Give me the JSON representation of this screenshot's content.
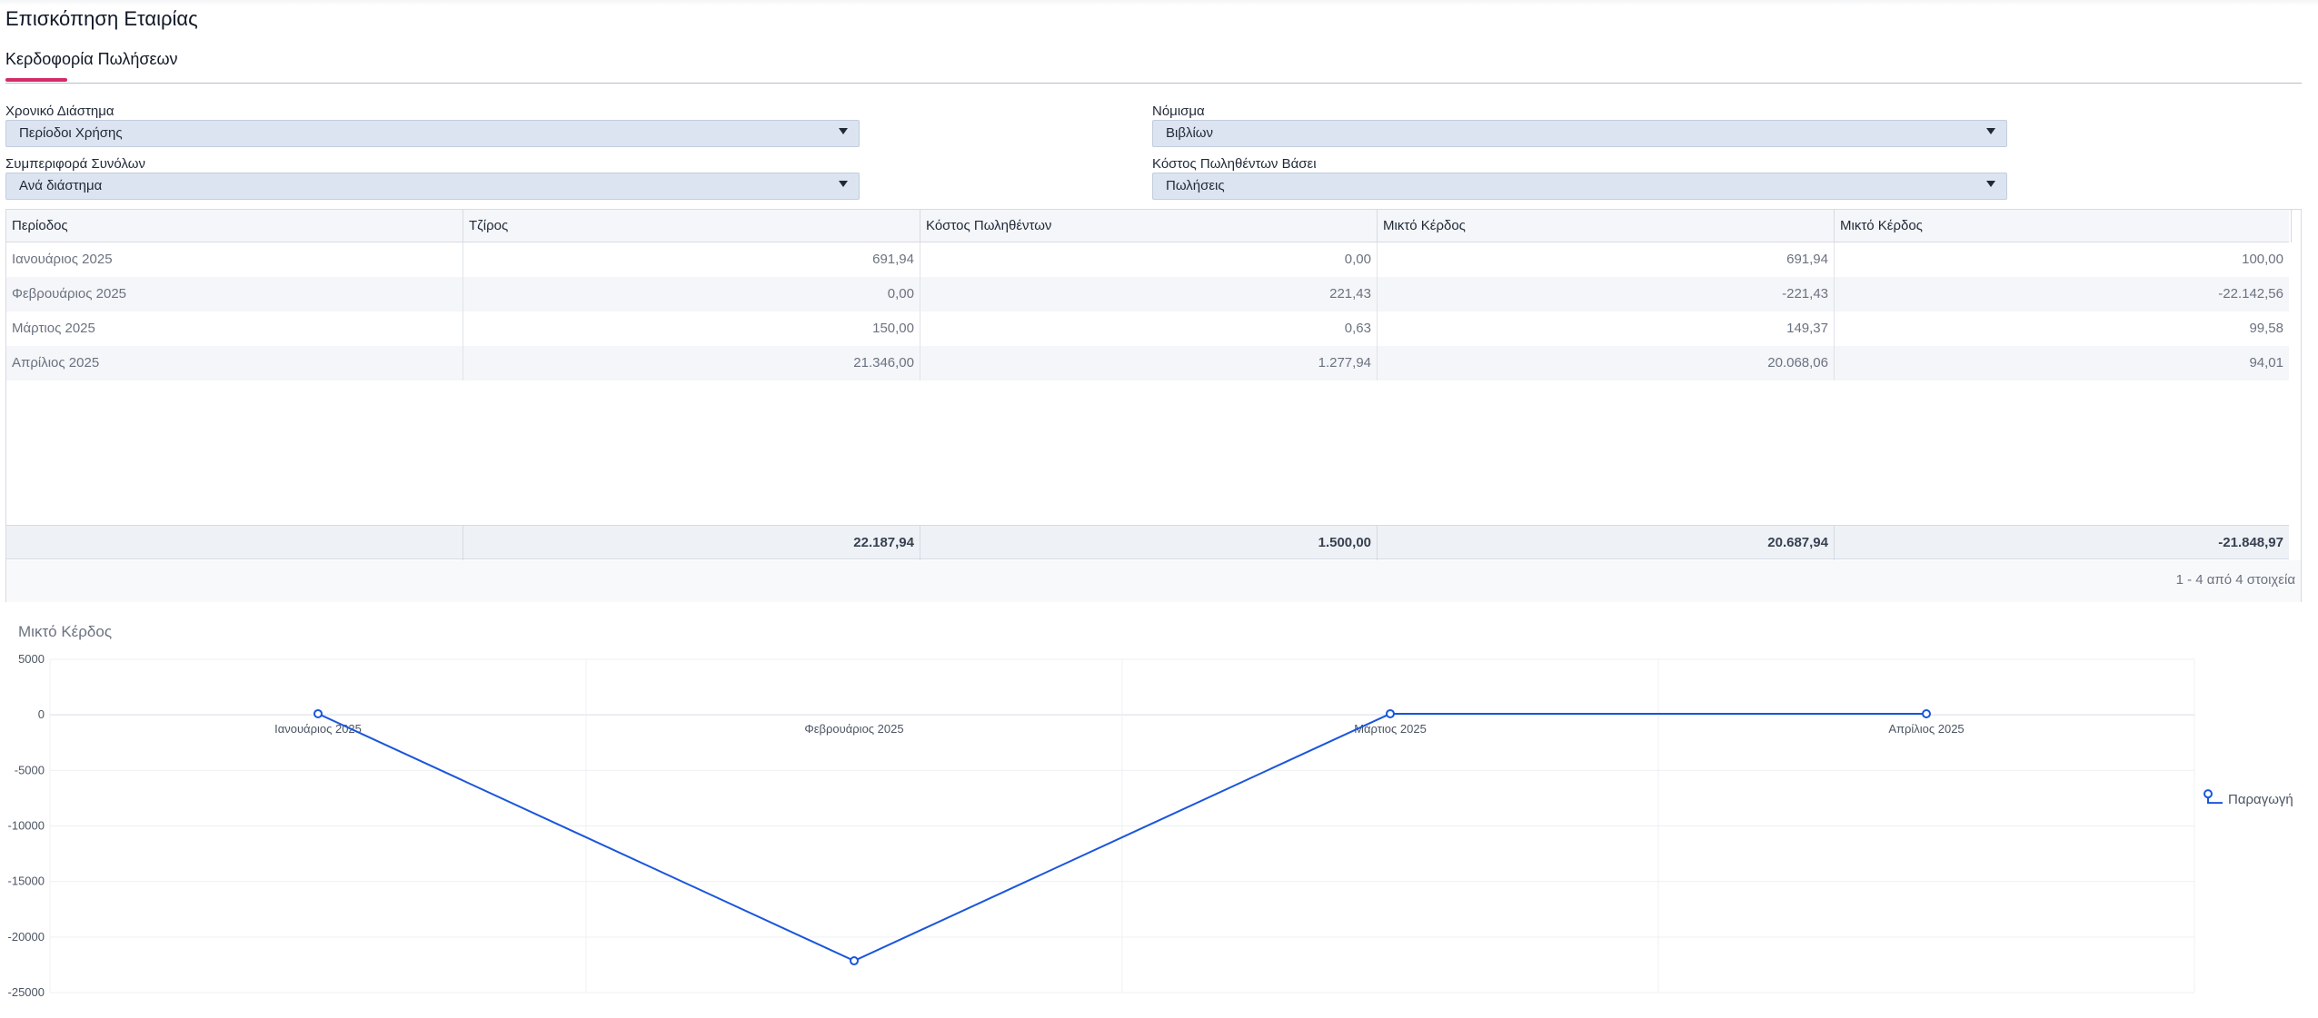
{
  "page": {
    "title": "Επισκόπηση Εταιρίας"
  },
  "tabs": [
    {
      "label": "Κερδοφορία Πωλήσεων",
      "active": true
    }
  ],
  "filters": {
    "time_range": {
      "label": "Χρονικό Διάστημα",
      "value": "Περίοδοι Χρήσης"
    },
    "currency": {
      "label": "Νόμισμα",
      "value": "Βιβλίων"
    },
    "totals_behavior": {
      "label": "Συμπεριφορά Συνόλων",
      "value": "Ανά διάστημα"
    },
    "cogs_basis": {
      "label": "Κόστος Πωληθέντων Βάσει",
      "value": "Πωλήσεις"
    }
  },
  "table": {
    "columns": [
      "Περίοδος",
      "Τζίρος",
      "Κόστος Πωληθέντων",
      "Μικτό Κέρδος",
      "Μικτό Κέρδος"
    ],
    "rows": [
      [
        "Ιανουάριος 2025",
        "691,94",
        "0,00",
        "691,94",
        "100,00"
      ],
      [
        "Φεβρουάριος 2025",
        "0,00",
        "221,43",
        "-221,43",
        "-22.142,56"
      ],
      [
        "Μάρτιος 2025",
        "150,00",
        "0,63",
        "149,37",
        "99,58"
      ],
      [
        "Απρίλιος 2025",
        "21.346,00",
        "1.277,94",
        "20.068,06",
        "94,01"
      ]
    ],
    "totals": [
      "",
      "22.187,94",
      "1.500,00",
      "20.687,94",
      "-21.848,97"
    ],
    "pager": "1 - 4 από 4 στοιχεία"
  },
  "chart_data": {
    "type": "line",
    "title": "Μικτό Κέρδος",
    "categories": [
      "Ιανουάριος 2025",
      "Φεβρουάριος 2025",
      "Μάρτιος 2025",
      "Απρίλιος 2025"
    ],
    "series": [
      {
        "name": "Παραγωγή",
        "values": [
          100.0,
          -22142.56,
          99.58,
          94.01
        ],
        "color": "#1a56db"
      }
    ],
    "ylim": [
      -25000,
      5000
    ],
    "yticks": [
      5000,
      0,
      -5000,
      -10000,
      -15000,
      -20000,
      -25000
    ],
    "grid": true,
    "legend": "right"
  }
}
